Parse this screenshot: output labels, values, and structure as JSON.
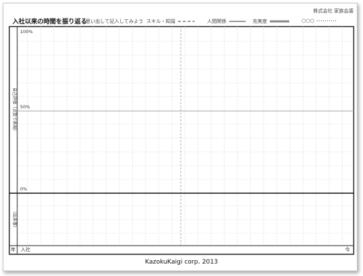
{
  "header": {
    "company": "株式会社 家族会議",
    "title": "入社以来の時間を振り返る",
    "hint": "思い出して記入してみよう"
  },
  "legend": [
    {
      "label": "スキル・知識",
      "style": "dashed",
      "color": "#333333"
    },
    {
      "label": "人間関係",
      "style": "solid-thin",
      "color": "#333333"
    },
    {
      "label": "充実度",
      "style": "solid-thick",
      "color": "#888888"
    },
    {
      "label": "○○○",
      "style": "dotted",
      "color": "#333333"
    }
  ],
  "chart": {
    "y_ticks": [
      "100%",
      "50%",
      "0%"
    ],
    "upper_side_label": "自己評価（点数で表現）",
    "lower_side_label": "（出来事）",
    "bottom_left_label": "年",
    "bottom_start_label": "入社",
    "bottom_end_label": "今"
  },
  "footer": "KazokuKaigi corp. 2013"
}
